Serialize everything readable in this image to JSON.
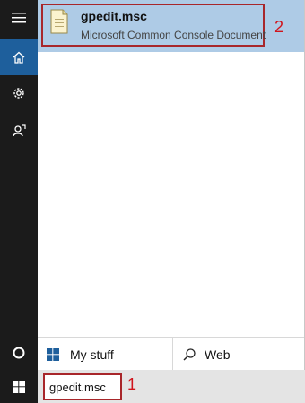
{
  "sidebar": {
    "items": [
      {
        "name": "hamburger-menu-icon"
      },
      {
        "name": "home-icon",
        "active": true
      },
      {
        "name": "gear-icon"
      },
      {
        "name": "feedback-icon"
      },
      {
        "name": "cortana-circle-icon"
      }
    ]
  },
  "result": {
    "title": "gpedit.msc",
    "subtitle": "Microsoft Common Console Document",
    "icon": "document-icon",
    "highlight_label": "2"
  },
  "filters": {
    "my_stuff": "My stuff",
    "web": "Web"
  },
  "taskbar": {
    "search_value": "gpedit.msc",
    "highlight_label": "1"
  },
  "colors": {
    "accent": "#1e5f9c",
    "selection": "#aecbe6",
    "annotation": "#a8262a",
    "sidebar": "#1b1b1b"
  }
}
